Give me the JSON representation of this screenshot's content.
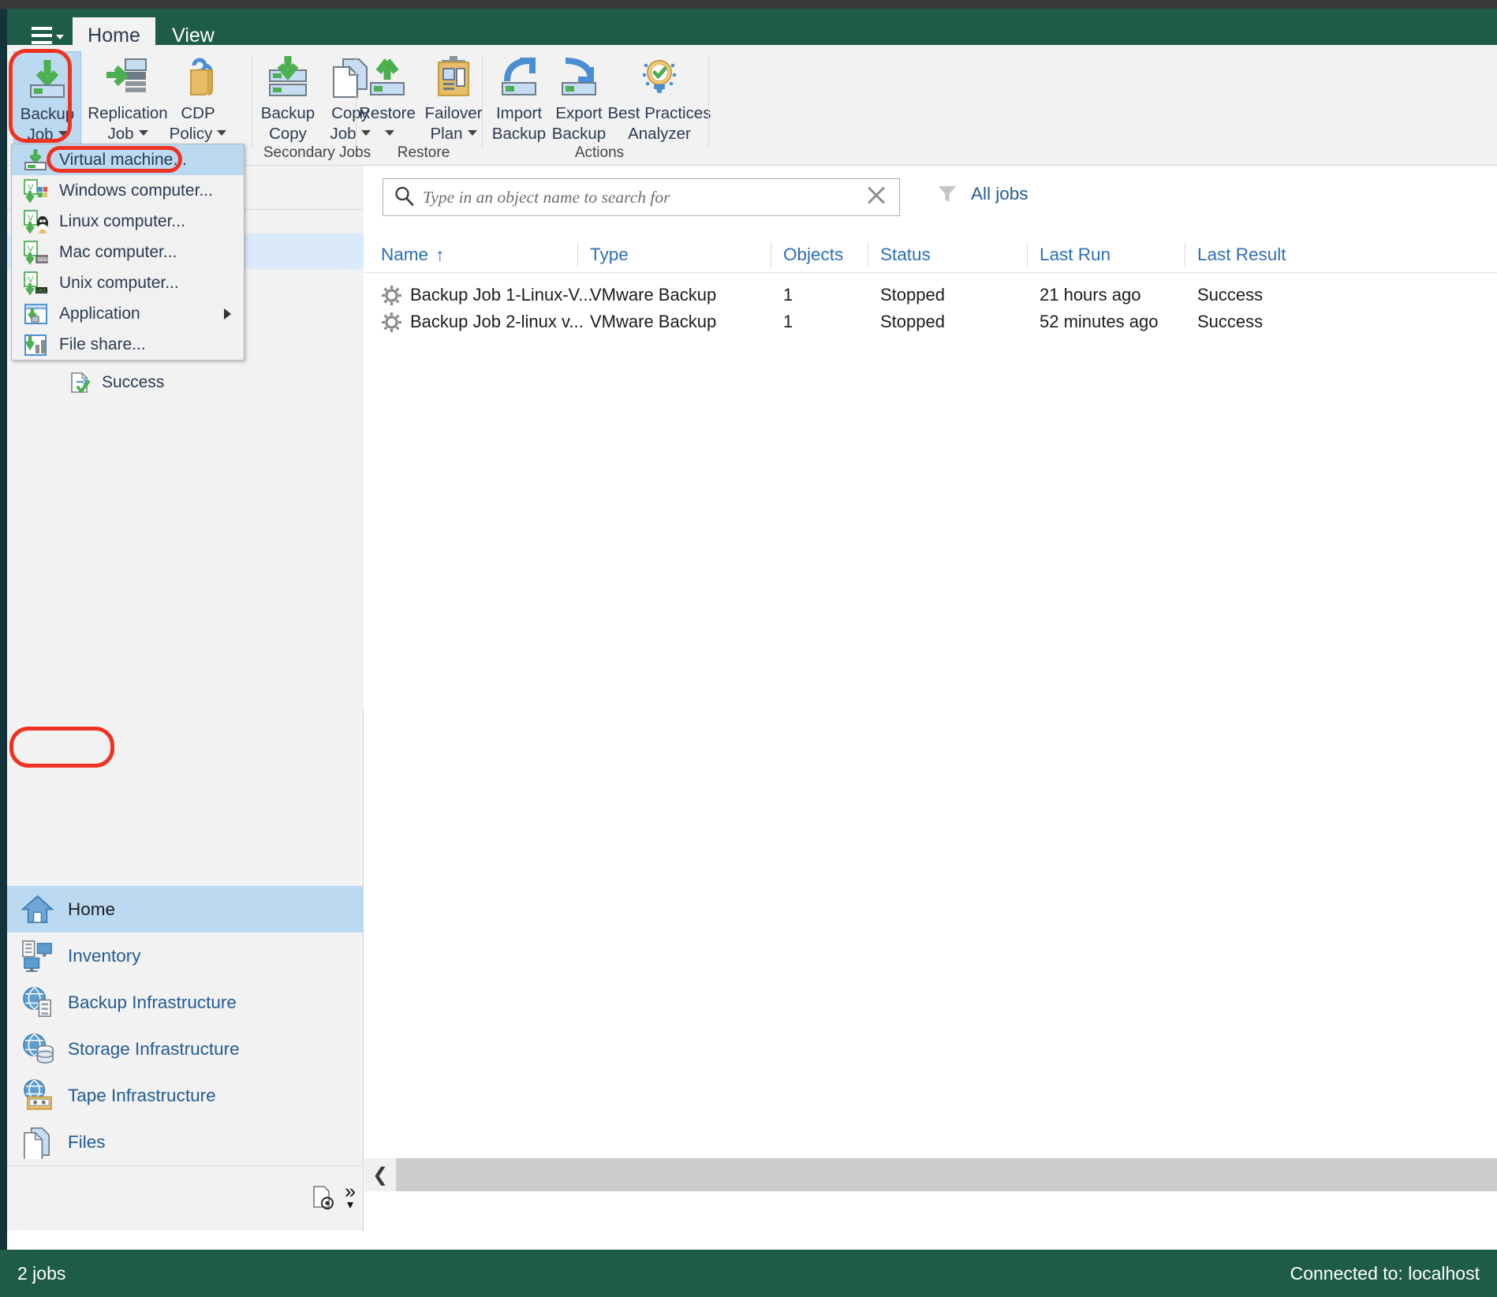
{
  "window": {
    "tabs": [
      {
        "label": "Home",
        "active": true
      },
      {
        "label": "View",
        "active": false
      }
    ],
    "menu_button": "main-menu"
  },
  "ribbon": {
    "groups": [
      {
        "label": "",
        "buttons": [
          {
            "name": "backup-job",
            "line1": "Backup",
            "line2": "Job",
            "dropdown": true,
            "selected": true,
            "icon": "backup-job-icon"
          },
          {
            "name": "replication-job",
            "line1": "Replication",
            "line2": "Job",
            "dropdown": true,
            "selected": false,
            "icon": "replication-job-icon"
          },
          {
            "name": "cdp-policy",
            "line1": "CDP",
            "line2": "Policy",
            "dropdown": true,
            "selected": false,
            "icon": "cdp-policy-icon"
          }
        ]
      },
      {
        "label": "Secondary Jobs",
        "buttons": [
          {
            "name": "backup-copy",
            "line1": "Backup",
            "line2": "Copy",
            "dropdown": false,
            "selected": false,
            "icon": "backup-copy-icon"
          },
          {
            "name": "copy-job",
            "line1": "Copy",
            "line2": "Job",
            "dropdown": true,
            "selected": false,
            "icon": "copy-job-icon"
          }
        ]
      },
      {
        "label": "Restore",
        "buttons": [
          {
            "name": "restore",
            "line1": "Restore",
            "line2": "",
            "dropdown": true,
            "selected": false,
            "icon": "restore-icon"
          },
          {
            "name": "failover-plan",
            "line1": "Failover",
            "line2": "Plan",
            "dropdown": true,
            "selected": false,
            "icon": "failover-plan-icon"
          }
        ]
      },
      {
        "label": "Actions",
        "buttons": [
          {
            "name": "import-backup",
            "line1": "Import",
            "line2": "Backup",
            "dropdown": false,
            "selected": false,
            "icon": "import-backup-icon"
          },
          {
            "name": "export-backup",
            "line1": "Export",
            "line2": "Backup",
            "dropdown": false,
            "selected": false,
            "icon": "export-backup-icon"
          },
          {
            "name": "best-practices-analyzer",
            "line1": "Best Practices",
            "line2": "Analyzer",
            "dropdown": false,
            "selected": false,
            "icon": "best-practices-icon"
          }
        ]
      }
    ],
    "group_labels": {
      "secondary_jobs": "Secondary Jobs",
      "restore": "Restore",
      "actions": "Actions"
    }
  },
  "backup_job_menu": {
    "items": [
      {
        "label": "Virtual machine...",
        "icon": "virtual-machine-icon",
        "selected": true,
        "submenu": false
      },
      {
        "label": "Windows computer...",
        "icon": "windows-computer-icon",
        "selected": false,
        "submenu": false
      },
      {
        "label": "Linux computer...",
        "icon": "linux-computer-icon",
        "selected": false,
        "submenu": false
      },
      {
        "label": "Mac computer...",
        "icon": "mac-computer-icon",
        "selected": false,
        "submenu": false
      },
      {
        "label": "Unix computer...",
        "icon": "unix-computer-icon",
        "selected": false,
        "submenu": false
      },
      {
        "label": "Application",
        "icon": "application-icon",
        "selected": false,
        "submenu": true
      },
      {
        "label": "File share...",
        "icon": "file-share-icon",
        "selected": false,
        "submenu": false
      }
    ]
  },
  "tree": {
    "visible_items": [
      {
        "label": "Success",
        "icon": "success-job-icon"
      }
    ]
  },
  "navigation": {
    "items": [
      {
        "label": "Home",
        "icon": "home-icon",
        "active": true
      },
      {
        "label": "Inventory",
        "icon": "inventory-icon",
        "active": false
      },
      {
        "label": "Backup Infrastructure",
        "icon": "backup-infrastructure-icon",
        "active": false
      },
      {
        "label": "Storage Infrastructure",
        "icon": "storage-infrastructure-icon",
        "active": false
      },
      {
        "label": "Tape Infrastructure",
        "icon": "tape-infrastructure-icon",
        "active": false
      },
      {
        "label": "Files",
        "icon": "files-icon",
        "active": false
      }
    ],
    "footer": {
      "config_icon": "configure-panel-icon",
      "expand_icon": "chevron-double-right-icon",
      "more_icon": "chevron-down-icon"
    }
  },
  "search": {
    "placeholder": "Type in an object name to search for",
    "value": "",
    "icon": "search-icon",
    "clear_icon": "clear-icon"
  },
  "filter": {
    "label": "All jobs",
    "icon": "filter-icon"
  },
  "jobs_table": {
    "columns": [
      {
        "key": "name",
        "label": "Name",
        "sorted": "asc"
      },
      {
        "key": "type",
        "label": "Type",
        "sorted": ""
      },
      {
        "key": "objects",
        "label": "Objects",
        "sorted": ""
      },
      {
        "key": "status",
        "label": "Status",
        "sorted": ""
      },
      {
        "key": "last_run",
        "label": "Last Run",
        "sorted": ""
      },
      {
        "key": "last_result",
        "label": "Last Result",
        "sorted": ""
      }
    ],
    "sort_indicator": "↑",
    "rows": [
      {
        "name": "Backup Job 1-Linux-V...",
        "type": "VMware Backup",
        "objects": "1",
        "status": "Stopped",
        "last_run": "21 hours ago",
        "last_result": "Success",
        "icon": "job-gear-icon"
      },
      {
        "name": "Backup Job 2-linux v...",
        "type": "VMware Backup",
        "objects": "1",
        "status": "Stopped",
        "last_run": "52 minutes ago",
        "last_result": "Success",
        "icon": "job-gear-icon"
      }
    ]
  },
  "status_bar": {
    "left": "2 jobs",
    "right": "Connected to: localhost"
  },
  "colors": {
    "brand_green": "#1e5c48",
    "accent_blue": "#235b94",
    "selection_blue": "#bcd9f2",
    "highlight_ring": "#ee3322"
  }
}
